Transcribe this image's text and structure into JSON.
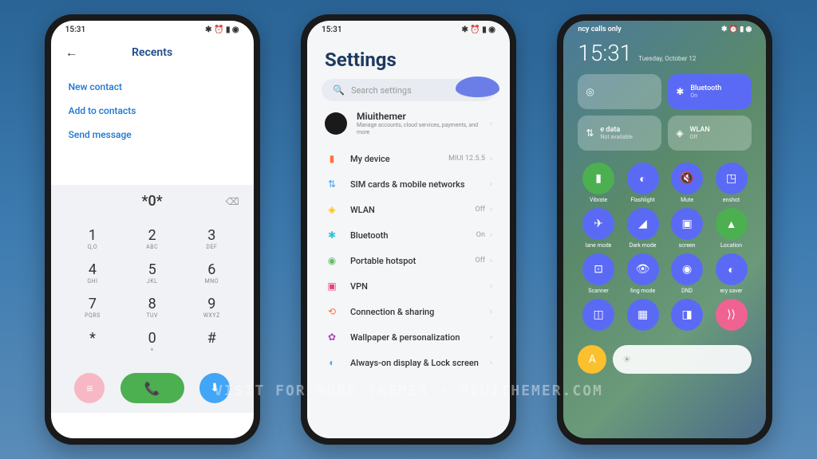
{
  "statusbar": {
    "time": "15:31",
    "indicators": "✱ ⏰ ▮ ◉"
  },
  "phone1": {
    "title": "Recents",
    "menu": [
      "New contact",
      "Add to contacts",
      "Send message"
    ],
    "input": "*0*",
    "keys": [
      [
        {
          "n": "1",
          "s": "Q,O"
        },
        {
          "n": "2",
          "s": "ABC"
        },
        {
          "n": "3",
          "s": "DEF"
        }
      ],
      [
        {
          "n": "4",
          "s": "GHI"
        },
        {
          "n": "5",
          "s": "JKL"
        },
        {
          "n": "6",
          "s": "MNO"
        }
      ],
      [
        {
          "n": "7",
          "s": "PQRS"
        },
        {
          "n": "8",
          "s": "TUV"
        },
        {
          "n": "9",
          "s": "WXYZ"
        }
      ],
      [
        {
          "n": "*",
          "s": ""
        },
        {
          "n": "0",
          "s": "+"
        },
        {
          "n": "#",
          "s": ""
        }
      ]
    ]
  },
  "phone2": {
    "title": "Settings",
    "search_placeholder": "Search settings",
    "account": {
      "name": "Miuithemer",
      "sub": "Manage accounts, cloud services, payments, and more"
    },
    "items": [
      {
        "icon": "▮",
        "iconClass": "ic-orange",
        "label": "My device",
        "value": "MIUI 12.5.5"
      },
      {
        "icon": "⇅",
        "iconClass": "ic-blue",
        "label": "SIM cards & mobile networks",
        "value": ""
      },
      {
        "icon": "◈",
        "iconClass": "ic-yellow",
        "label": "WLAN",
        "value": "Off"
      },
      {
        "icon": "✱",
        "iconClass": "ic-cyan",
        "label": "Bluetooth",
        "value": "On"
      },
      {
        "icon": "◉",
        "iconClass": "ic-green",
        "label": "Portable hotspot",
        "value": "Off"
      },
      {
        "icon": "▣",
        "iconClass": "ic-pink",
        "label": "VPN",
        "value": ""
      },
      {
        "icon": "⟲",
        "iconClass": "ic-orange",
        "label": "Connection & sharing",
        "value": ""
      },
      {
        "icon": "✿",
        "iconClass": "ic-purple",
        "label": "Wallpaper & personalization",
        "value": ""
      },
      {
        "icon": "◐",
        "iconClass": "ic-blue",
        "label": "Always-on display & Lock screen",
        "value": ""
      }
    ]
  },
  "phone3": {
    "carrier": "ncy calls only",
    "clock": "15:31",
    "date": "Tuesday, October 12",
    "tiles_large": [
      {
        "icon": "◎",
        "title": "",
        "sub": "",
        "class": "dim"
      },
      {
        "icon": "✱",
        "title": "Bluetooth",
        "sub": "On",
        "class": "active"
      },
      {
        "icon": "⇅",
        "title": "e data",
        "sub": "Not available",
        "class": "dim"
      },
      {
        "icon": "◈",
        "title": "WLAN",
        "sub": "Off",
        "class": "dim"
      }
    ],
    "tiles_small": [
      {
        "icon": "▮",
        "label": "Vibrate",
        "class": "tc-green"
      },
      {
        "icon": "◐",
        "label": "Flashlight",
        "class": "tc-blue"
      },
      {
        "icon": "🔇",
        "label": "Mute",
        "class": "tc-blue"
      },
      {
        "icon": "◳",
        "label": "enshot",
        "class": "tc-blue"
      },
      {
        "icon": "✈",
        "label": "lane mode",
        "class": "tc-blue"
      },
      {
        "icon": "◢",
        "label": "Dark mode",
        "class": "tc-blue"
      },
      {
        "icon": "▣",
        "label": "screen",
        "class": "tc-blue"
      },
      {
        "icon": "▲",
        "label": "Location",
        "class": "tc-green"
      },
      {
        "icon": "⊡",
        "label": "Scanner",
        "class": "tc-blue"
      },
      {
        "icon": "👁",
        "label": "fing mode",
        "class": "tc-blue"
      },
      {
        "icon": "◉",
        "label": "DND",
        "class": "tc-blue"
      },
      {
        "icon": "◐",
        "label": "ery saver",
        "class": "tc-blue"
      },
      {
        "icon": "◫",
        "label": "",
        "class": "tc-blue"
      },
      {
        "icon": "▦",
        "label": "",
        "class": "tc-blue"
      },
      {
        "icon": "◨",
        "label": "",
        "class": "tc-blue"
      },
      {
        "icon": "⟩⟩",
        "label": "",
        "class": "tc-pink"
      }
    ]
  },
  "watermark": "VISIT FOR MORE THEMES - MIUITHEMER.COM"
}
